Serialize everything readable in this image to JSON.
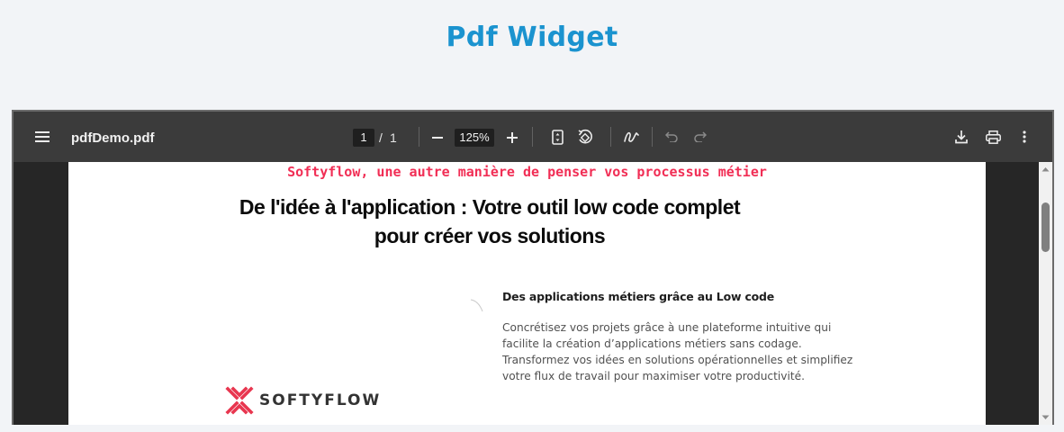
{
  "page": {
    "title": "Pdf Widget"
  },
  "viewer": {
    "file_name": "pdfDemo.pdf",
    "current_page": "1",
    "page_separator": "/",
    "total_pages": "1",
    "zoom": "125%",
    "icons": {
      "menu": "menu-icon",
      "zoom_out": "minus-icon",
      "zoom_in": "plus-icon",
      "fit": "fit-page-icon",
      "rotate": "rotate-icon",
      "annotate": "draw-icon",
      "undo": "undo-icon",
      "redo": "redo-icon",
      "download": "download-icon",
      "print": "print-icon",
      "more": "more-vert-icon"
    }
  },
  "document": {
    "tagline": "Softyflow, une autre manière de penser vos processus métier",
    "headline_line1": "De l'idée à l'application : Votre outil low code complet",
    "headline_line2": "pour créer vos solutions",
    "subheading": "Des applications métiers grâce au Low code",
    "paragraph": "Concrétisez vos projets grâce à une plateforme intuitive qui facilite la création d’applications métiers sans codage. Transformez vos idées en solutions opérationnelles et simplifiez votre flux de travail pour maximiser votre productivité.",
    "logo_text": "SOFTYFLOW"
  },
  "colors": {
    "title": "#1b93cf",
    "tagline": "#f12e55",
    "logo_mark": "#e8364f",
    "toolbar": "#3b3b3b"
  }
}
